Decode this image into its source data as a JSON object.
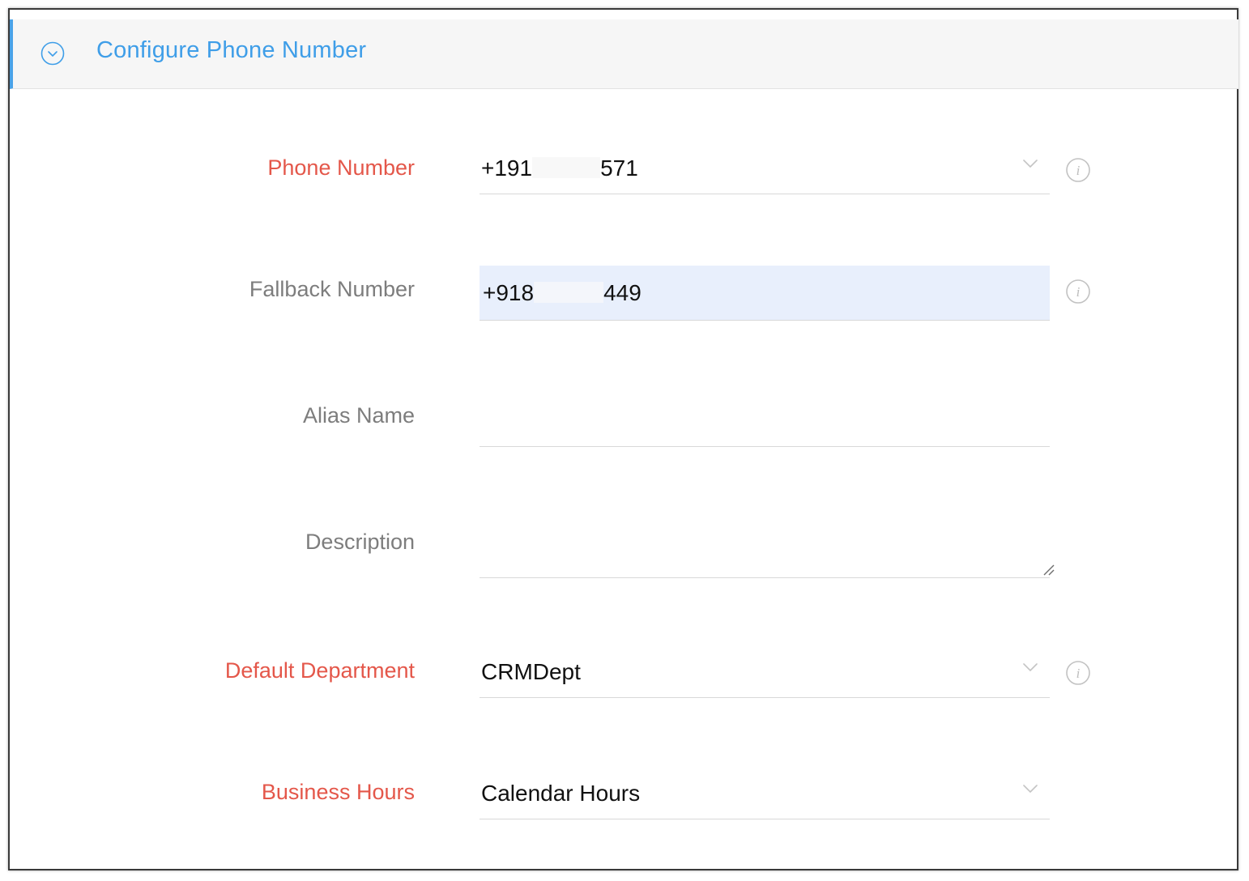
{
  "section": {
    "title": "Configure Phone Number",
    "toggle_icon": "chevron-circle-icon",
    "accent_color": "#3f9ee8"
  },
  "fields": {
    "phone_number": {
      "label": "Phone Number",
      "required": true,
      "value_prefix": "+191",
      "value_suffix": "571",
      "type": "select"
    },
    "fallback_number": {
      "label": "Fallback Number",
      "required": false,
      "value_prefix": "+918",
      "value_suffix": "449",
      "type": "text"
    },
    "alias_name": {
      "label": "Alias Name",
      "required": false,
      "value": "",
      "type": "text"
    },
    "description": {
      "label": "Description",
      "required": false,
      "value": "",
      "type": "textarea"
    },
    "default_department": {
      "label": "Default Department",
      "required": true,
      "value": "CRMDept",
      "type": "select"
    },
    "business_hours": {
      "label": "Business Hours",
      "required": true,
      "value": "Calendar Hours",
      "type": "select"
    }
  },
  "colors": {
    "required_label": "#e4574a",
    "optional_label": "#7d7d7d",
    "highlight_bg": "#e8effc"
  }
}
